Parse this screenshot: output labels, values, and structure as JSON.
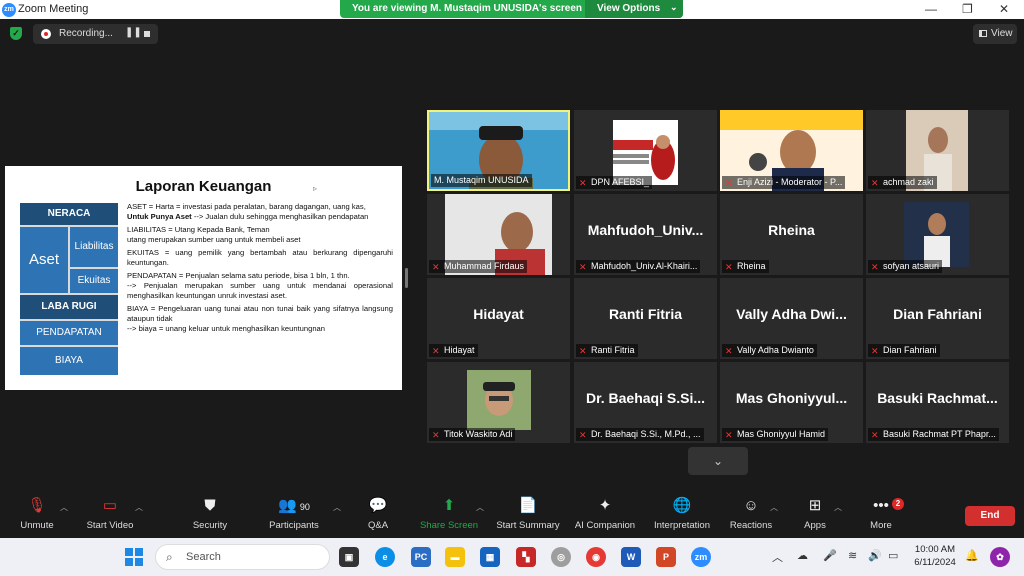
{
  "window": {
    "title": "Zoom Meeting",
    "banner_text": "You are viewing M. Mustaqim UNUSIDA's screen",
    "view_options_label": "View Options",
    "minimize": "—",
    "restore": "❐",
    "close": "✕"
  },
  "topbar": {
    "recording_label": "Recording...",
    "pause_glyph": "❚❚",
    "view_label": "View"
  },
  "shared_screen": {
    "title": "Laporan Keuangan",
    "diagram": {
      "neraca": "NERACA",
      "aset": "Aset",
      "liabilitas": "Liabilitas",
      "ekuitas": "Ekuitas",
      "laba_rugi": "LABA RUGI",
      "pendapatan": "PENDAPATAN",
      "biaya": "BIAYA"
    },
    "text": {
      "aset_line": "ASET = Harta = investasi pada peralatan, barang dagangan, uang kas,",
      "aset_bold": "Untuk Punya Aset",
      "aset_rest": " --> Jualan dulu sehingga menghasilkan pendapatan",
      "liab_1": "LIABILITAS = Utang Kepada Bank, Teman",
      "liab_2": "utang merupakan sumber uang untuk membeli aset",
      "ekuitas": "EKUITAS = uang pemilik yang bertambah atau berkurang dipengaruhi keuntungan.",
      "pend_1": "PENDAPATAN = Penjualan selama satu periode, bisa 1 bln, 1 thn.",
      "pend_2": "--> Penjualan merupakan sumber uang untuk mendanai operasional menghasilkan keuntungan unruk investasi aset.",
      "biaya_1": "BIAYA = Pengeluaran uang tunai atau non tunai baik yang sifatnya langsung ataupun tidak",
      "biaya_2": "--> biaya = unang keluar untuk menghasilkan keuntungnan"
    }
  },
  "participants": [
    {
      "label": "M. Mustaqim UNUSIDA",
      "big": "",
      "active": true
    },
    {
      "label": "DPN AFEBSI_",
      "big": ""
    },
    {
      "label": "Enji Azizi - Moderator - P...",
      "big": ""
    },
    {
      "label": "achmad zaki",
      "big": ""
    },
    {
      "label": "Muhammad Firdaus",
      "big": ""
    },
    {
      "label": "Mahfudoh_Univ.Al-Khairi...",
      "big": "Mahfudoh_Univ..."
    },
    {
      "label": "Rheina",
      "big": "Rheina"
    },
    {
      "label": "sofyan atsauri",
      "big": ""
    },
    {
      "label": "Hidayat",
      "big": "Hidayat"
    },
    {
      "label": "Ranti Fitria",
      "big": "Ranti Fitria"
    },
    {
      "label": "Vally Adha Dwianto",
      "big": "Vally Adha Dwi..."
    },
    {
      "label": "Dian Fahriani",
      "big": "Dian Fahriani"
    },
    {
      "label": "Titok Waskito Adi",
      "big": ""
    },
    {
      "label": "Dr. Baehaqi S.Si., M.Pd., ...",
      "big": "Dr. Baehaqi S.Si..."
    },
    {
      "label": "Mas Ghoniyyul Hamid",
      "big": "Mas Ghoniyyul..."
    },
    {
      "label": "Basuki Rachmat PT Phapr...",
      "big": "Basuki Rachmat..."
    }
  ],
  "toolbar": {
    "unmute": "Unmute",
    "start_video": "Start Video",
    "security": "Security",
    "participants": "Participants",
    "participants_count": "90",
    "qa": "Q&A",
    "share_screen": "Share Screen",
    "start_summary": "Start Summary",
    "ai_companion": "AI Companion",
    "interpretation": "Interpretation",
    "reactions": "Reactions",
    "apps": "Apps",
    "more": "More",
    "more_badge": "2",
    "end": "End"
  },
  "taskbar": {
    "search_placeholder": "Search",
    "time": "10:00 AM",
    "date": "6/11/2024"
  },
  "colors": {
    "banner_green": "#23a84a",
    "end_red": "#d32f2f",
    "active_border": "#f3f37a",
    "share_green": "#23a84a"
  }
}
